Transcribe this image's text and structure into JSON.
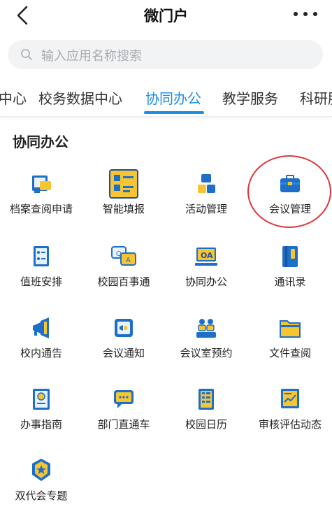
{
  "header": {
    "title": "微门户"
  },
  "search": {
    "placeholder": "输入应用名称搜索"
  },
  "tabs": [
    {
      "label": "中心"
    },
    {
      "label": "校务数据中心"
    },
    {
      "label": "协同办公"
    },
    {
      "label": "教学服务"
    },
    {
      "label": "科研服"
    }
  ],
  "active_tab": "协同办公",
  "section": {
    "title": "协同办公"
  },
  "apps": [
    {
      "label": "档案查阅申请",
      "icon": "archive-icon"
    },
    {
      "label": "智能填报",
      "icon": "smart-form-icon"
    },
    {
      "label": "活动管理",
      "icon": "activity-icon"
    },
    {
      "label": "会议管理",
      "icon": "briefcase-icon"
    },
    {
      "label": "值班安排",
      "icon": "duty-icon"
    },
    {
      "label": "校园百事通",
      "icon": "qa-chat-icon"
    },
    {
      "label": "协同办公",
      "icon": "oa-icon"
    },
    {
      "label": "通讯录",
      "icon": "contacts-icon"
    },
    {
      "label": "校内通告",
      "icon": "megaphone-icon"
    },
    {
      "label": "会议通知",
      "icon": "meeting-notice-icon"
    },
    {
      "label": "会议室预约",
      "icon": "meeting-room-icon"
    },
    {
      "label": "文件查阅",
      "icon": "folder-icon"
    },
    {
      "label": "办事指南",
      "icon": "guide-icon"
    },
    {
      "label": "部门直通车",
      "icon": "message-icon"
    },
    {
      "label": "校园日历",
      "icon": "calendar-icon"
    },
    {
      "label": "审核评估动态",
      "icon": "evaluation-icon"
    },
    {
      "label": "双代会专题",
      "icon": "badge-icon"
    }
  ],
  "colors": {
    "accent": "#1a8fe3",
    "icon_blue": "#1e6fc7",
    "icon_yellow": "#f7c531",
    "highlight": "#e0353b"
  }
}
